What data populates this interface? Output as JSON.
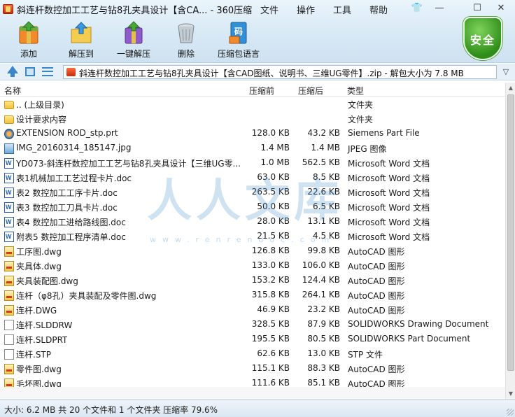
{
  "window": {
    "title": "斜连杆数控加工工艺与钻8孔夹具设计【含CA... - 360压缩",
    "menus": [
      "文件",
      "操作",
      "工具",
      "帮助"
    ],
    "controls": [
      "👕",
      "—",
      "☐",
      "✕"
    ]
  },
  "toolbar": {
    "add": "添加",
    "extract_to": "解压到",
    "one_click_extract": "一键解压",
    "delete": "删除",
    "compress_lang": "压缩包语言",
    "lang_badge": "码"
  },
  "security_badge": "安全",
  "address": {
    "path": "斜连杆数控加工工艺与钻8孔夹具设计【含CAD图纸、说明书、三维UG零件】.zip - 解包大小为 7.8 MB"
  },
  "columns": {
    "name": "名称",
    "original_size": "压缩前",
    "compressed_size": "压缩后",
    "type": "类型"
  },
  "files": [
    {
      "icon": "folder",
      "name": ".. (上级目录)",
      "orig": "",
      "comp": "",
      "type": "文件夹"
    },
    {
      "icon": "folder",
      "name": "设计要求内容",
      "orig": "",
      "comp": "",
      "type": "文件夹"
    },
    {
      "icon": "prt",
      "name": "EXTENSION ROD_stp.prt",
      "orig": "128.0 KB",
      "comp": "43.2 KB",
      "type": "Siemens Part File"
    },
    {
      "icon": "img",
      "name": "IMG_20160314_185147.jpg",
      "orig": "1.4 MB",
      "comp": "1.4 MB",
      "type": "JPEG 图像"
    },
    {
      "icon": "doc",
      "name": "YD073-斜连杆数控加工工艺与钻8孔夹具设计【三维UG零...",
      "orig": "1.0 MB",
      "comp": "562.5 KB",
      "type": "Microsoft Word 文档"
    },
    {
      "icon": "doc",
      "name": "表1机械加工工艺过程卡片.doc",
      "orig": "63.0 KB",
      "comp": "8.5 KB",
      "type": "Microsoft Word 文档"
    },
    {
      "icon": "doc",
      "name": "表2 数控加工工序卡片.doc",
      "orig": "263.5 KB",
      "comp": "22.6 KB",
      "type": "Microsoft Word 文档"
    },
    {
      "icon": "doc",
      "name": "表3 数控加工刀具卡片.doc",
      "orig": "50.0 KB",
      "comp": "6.5 KB",
      "type": "Microsoft Word 文档"
    },
    {
      "icon": "doc",
      "name": "表4 数控加工进给路线图.doc",
      "orig": "28.0 KB",
      "comp": "13.1 KB",
      "type": "Microsoft Word 文档"
    },
    {
      "icon": "doc",
      "name": "附表5  数控加工程序清单.doc",
      "orig": "21.5 KB",
      "comp": "4.5 KB",
      "type": "Microsoft Word 文档"
    },
    {
      "icon": "dwg",
      "name": "工序图.dwg",
      "orig": "126.8 KB",
      "comp": "99.8 KB",
      "type": "AutoCAD 图形"
    },
    {
      "icon": "dwg",
      "name": "夹具体.dwg",
      "orig": "133.0 KB",
      "comp": "106.0 KB",
      "type": "AutoCAD 图形"
    },
    {
      "icon": "dwg",
      "name": "夹具装配图.dwg",
      "orig": "153.2 KB",
      "comp": "124.4 KB",
      "type": "AutoCAD 图形"
    },
    {
      "icon": "dwg",
      "name": "连杆（φ8孔）夹具装配及零件图.dwg",
      "orig": "315.8 KB",
      "comp": "264.1 KB",
      "type": "AutoCAD 图形"
    },
    {
      "icon": "dwg",
      "name": "连杆.DWG",
      "orig": "46.9 KB",
      "comp": "23.2 KB",
      "type": "AutoCAD 图形"
    },
    {
      "icon": "blank",
      "name": "连杆.SLDDRW",
      "orig": "328.5 KB",
      "comp": "87.9 KB",
      "type": "SOLIDWORKS Drawing Document"
    },
    {
      "icon": "blank",
      "name": "连杆.SLDPRT",
      "orig": "195.5 KB",
      "comp": "80.5 KB",
      "type": "SOLIDWORKS Part Document"
    },
    {
      "icon": "blank",
      "name": "连杆.STP",
      "orig": "62.6 KB",
      "comp": "13.0 KB",
      "type": "STP 文件"
    },
    {
      "icon": "dwg",
      "name": "零件图.dwg",
      "orig": "115.1 KB",
      "comp": "88.3 KB",
      "type": "AutoCAD 图形"
    },
    {
      "icon": "dwg",
      "name": "毛坯图.dwg",
      "orig": "111.6 KB",
      "comp": "85.1 KB",
      "type": "AutoCAD 图形"
    }
  ],
  "watermark": {
    "text": "人人文库",
    "url": "www.renrendoc.com"
  },
  "status": {
    "text": "大小: 6.2 MB 共 20 个文件和 1 个文件夹 压缩率 79.6%"
  }
}
